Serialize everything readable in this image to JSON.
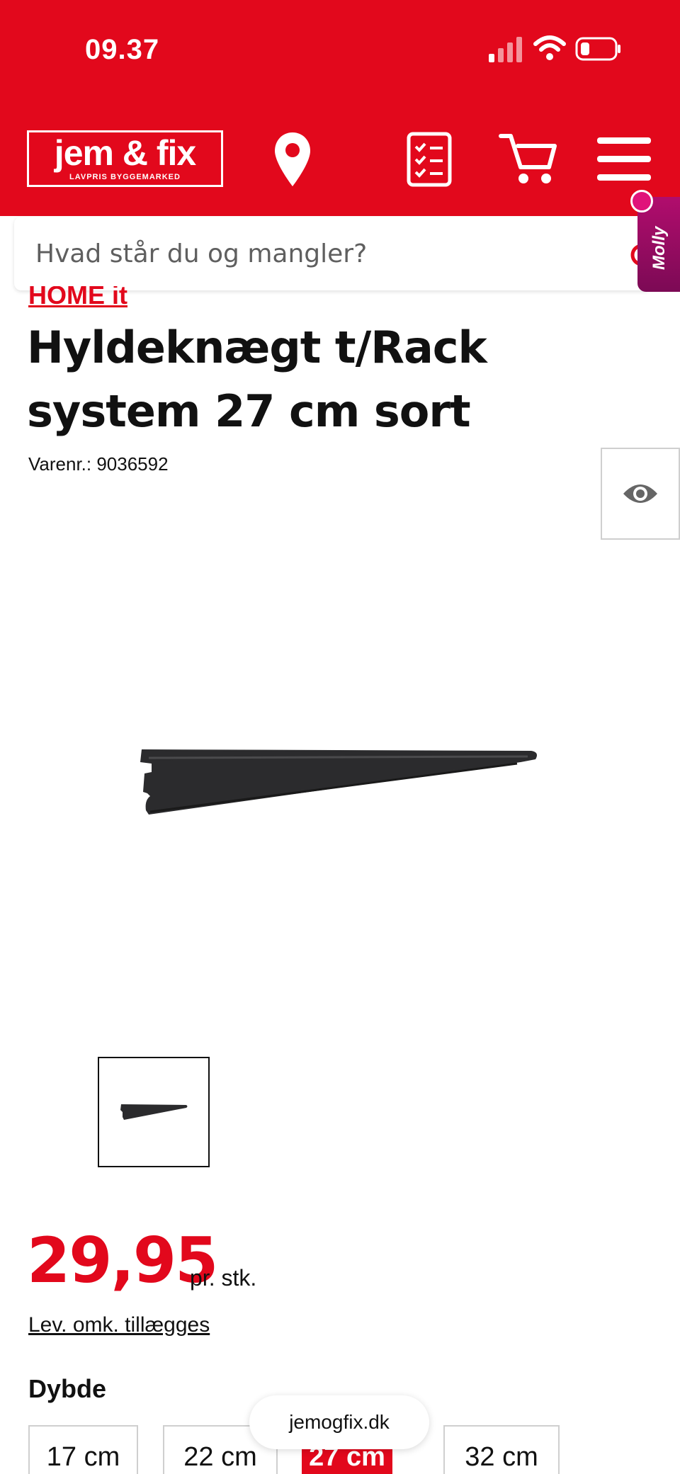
{
  "status_bar": {
    "time": "09.37"
  },
  "header": {
    "logo": {
      "main": "jem & fix",
      "sub": "LAVPRIS BYGGEMARKED"
    },
    "icons": [
      "location-pin-icon",
      "shopping-list-icon",
      "cart-icon",
      "menu-icon"
    ],
    "brand_color": "#e2081c"
  },
  "search": {
    "placeholder": "Hvad står du og mangler?"
  },
  "assistant": {
    "label": "Molly",
    "color": "#7c0a55"
  },
  "product": {
    "brand": "HOME it",
    "title": "Hyldeknægt t/Rack system 27 cm sort",
    "sku_label": "Varenr.: 9036592",
    "price": "29,95",
    "price_unit": "pr. stk.",
    "delivery_note": "Lev. omk. tillægges",
    "depth_label": "Dybde",
    "depth_options": [
      {
        "label": "17 cm",
        "selected": false
      },
      {
        "label": "22 cm",
        "selected": false
      },
      {
        "label": "27 cm",
        "selected": true
      },
      {
        "label": "32 cm",
        "selected": false
      }
    ]
  },
  "browser": {
    "url": "jemogfix.dk"
  }
}
